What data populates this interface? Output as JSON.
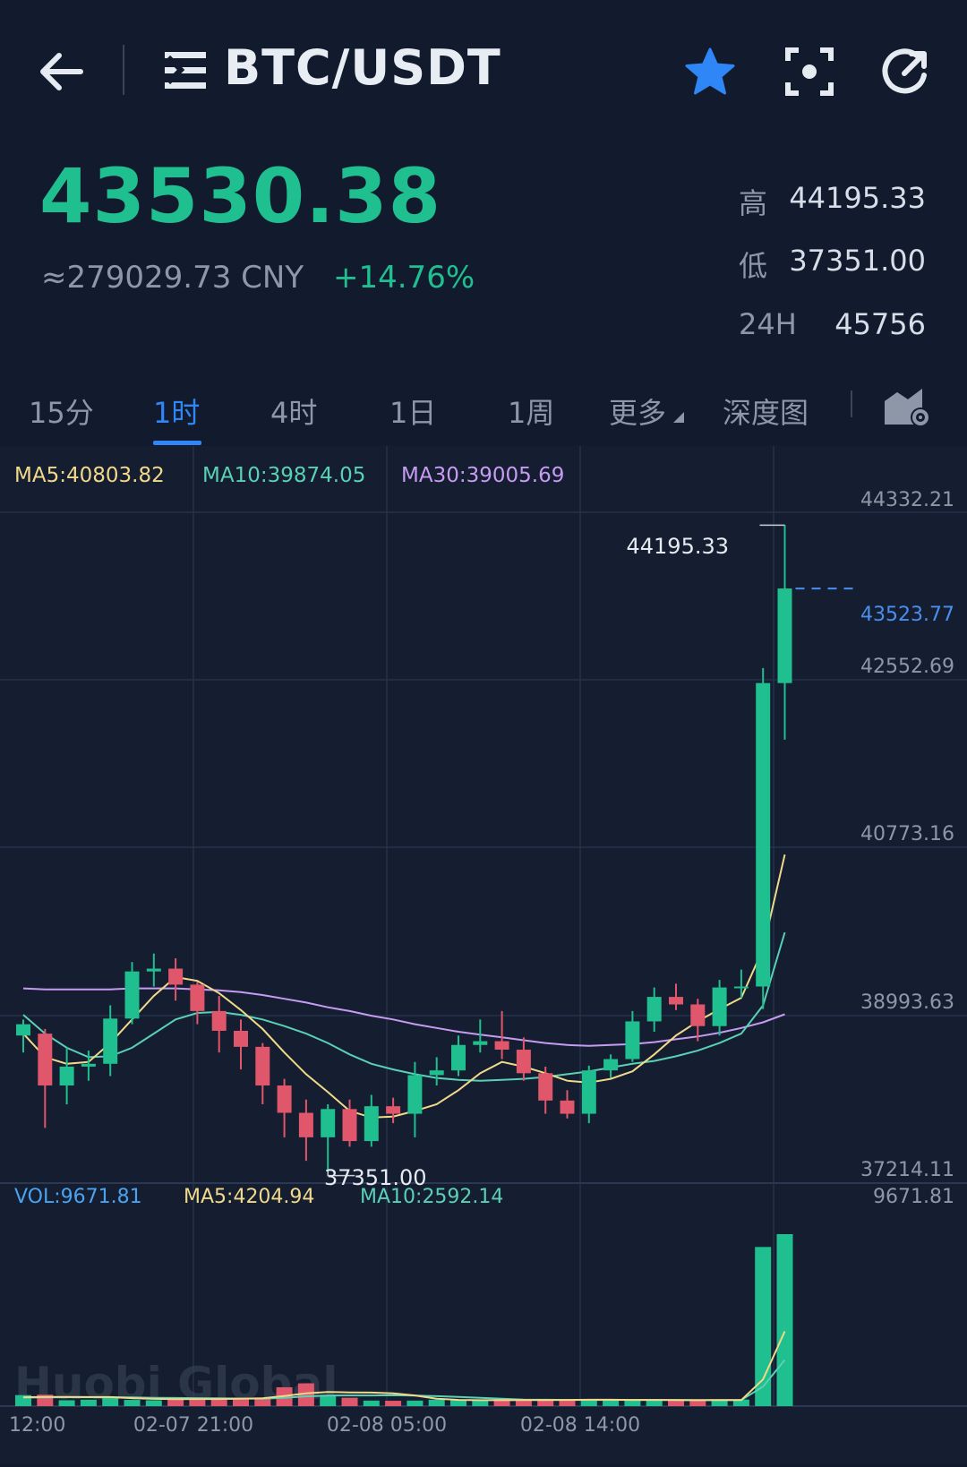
{
  "header": {
    "pair": "BTC/USDT",
    "icons": [
      "back-arrow-icon",
      "menu-icon",
      "star-icon",
      "scan-icon",
      "refresh-icon"
    ],
    "star_color": "#2f86f6"
  },
  "ticker": {
    "price": "43530.38",
    "cny": "≈279029.73 CNY",
    "change_pct": "+14.76%",
    "high_label": "高",
    "high_value": "44195.33",
    "low_label": "低",
    "low_value": "37351.00",
    "vol_label": "24H",
    "vol_value": "45756",
    "up_color": "#1fbf8f",
    "down_color": "#e0566b"
  },
  "tabs": [
    {
      "label": "15分",
      "active": false
    },
    {
      "label": "1时",
      "active": true
    },
    {
      "label": "4时",
      "active": false
    },
    {
      "label": "1日",
      "active": false
    },
    {
      "label": "1周",
      "active": false
    },
    {
      "label": "更多",
      "active": false
    },
    {
      "label": "深度图",
      "active": false
    }
  ],
  "indicators": {
    "ma5": "MA5:40803.82",
    "ma10": "MA10:39874.05",
    "ma30": "MA30:39005.69",
    "vol": "VOL:9671.81",
    "vol_ma5": "MA5:4204.94",
    "vol_ma10": "MA10:2592.14"
  },
  "watermark": "Huobi Global",
  "chart_data": {
    "type": "candlestick",
    "price_axis_labels": [
      "44332.21",
      "42552.69",
      "40773.16",
      "38993.63",
      "37214.11"
    ],
    "ylim": [
      37214.11,
      44332.21
    ],
    "volume_axis_label": "9671.81",
    "volume_max": 9671.81,
    "current_price_label": "43523.77",
    "current_price": 43523.77,
    "high_annotation": "44195.33",
    "low_annotation": "37351.00",
    "x_tick_labels": [
      "12:00",
      "02-07 21:00",
      "02-08 05:00",
      "02-08 14:00"
    ],
    "candles": [
      {
        "o": 38780,
        "h": 38950,
        "l": 38600,
        "c": 38900
      },
      {
        "o": 38800,
        "h": 38850,
        "l": 37800,
        "c": 38250
      },
      {
        "o": 38250,
        "h": 38650,
        "l": 38050,
        "c": 38450
      },
      {
        "o": 38450,
        "h": 38620,
        "l": 38300,
        "c": 38480
      },
      {
        "o": 38480,
        "h": 39100,
        "l": 38350,
        "c": 38960
      },
      {
        "o": 38960,
        "h": 39560,
        "l": 38900,
        "c": 39460
      },
      {
        "o": 39460,
        "h": 39650,
        "l": 39300,
        "c": 39490
      },
      {
        "o": 39490,
        "h": 39600,
        "l": 39150,
        "c": 39320
      },
      {
        "o": 39320,
        "h": 39350,
        "l": 38900,
        "c": 39040
      },
      {
        "o": 39040,
        "h": 39200,
        "l": 38600,
        "c": 38830
      },
      {
        "o": 38830,
        "h": 38950,
        "l": 38420,
        "c": 38660
      },
      {
        "o": 38660,
        "h": 38700,
        "l": 38050,
        "c": 38250
      },
      {
        "o": 38250,
        "h": 38320,
        "l": 37700,
        "c": 37960
      },
      {
        "o": 37960,
        "h": 38100,
        "l": 37450,
        "c": 37700
      },
      {
        "o": 37700,
        "h": 38050,
        "l": 37351,
        "c": 38000
      },
      {
        "o": 38000,
        "h": 38100,
        "l": 37600,
        "c": 37660
      },
      {
        "o": 37660,
        "h": 38150,
        "l": 37600,
        "c": 38030
      },
      {
        "o": 38030,
        "h": 38120,
        "l": 37850,
        "c": 37950
      },
      {
        "o": 37950,
        "h": 38500,
        "l": 37700,
        "c": 38360
      },
      {
        "o": 38360,
        "h": 38550,
        "l": 38250,
        "c": 38410
      },
      {
        "o": 38410,
        "h": 38780,
        "l": 38350,
        "c": 38680
      },
      {
        "o": 38680,
        "h": 38950,
        "l": 38600,
        "c": 38720
      },
      {
        "o": 38720,
        "h": 39040,
        "l": 38530,
        "c": 38630
      },
      {
        "o": 38630,
        "h": 38760,
        "l": 38300,
        "c": 38380
      },
      {
        "o": 38380,
        "h": 38450,
        "l": 37950,
        "c": 38090
      },
      {
        "o": 38090,
        "h": 38200,
        "l": 37900,
        "c": 37950
      },
      {
        "o": 37950,
        "h": 38460,
        "l": 37850,
        "c": 38410
      },
      {
        "o": 38410,
        "h": 38580,
        "l": 38330,
        "c": 38530
      },
      {
        "o": 38530,
        "h": 39040,
        "l": 38500,
        "c": 38930
      },
      {
        "o": 38930,
        "h": 39290,
        "l": 38820,
        "c": 39190
      },
      {
        "o": 39190,
        "h": 39330,
        "l": 39050,
        "c": 39110
      },
      {
        "o": 39110,
        "h": 39170,
        "l": 38720,
        "c": 38880
      },
      {
        "o": 38880,
        "h": 39370,
        "l": 38780,
        "c": 39290
      },
      {
        "o": 39290,
        "h": 39480,
        "l": 39180,
        "c": 39300
      },
      {
        "o": 39300,
        "h": 42680,
        "l": 39060,
        "c": 42520
      },
      {
        "o": 42520,
        "h": 44195.33,
        "l": 41920,
        "c": 43523.77
      }
    ],
    "ma5": [
      38800,
      38550,
      38480,
      38500,
      38700,
      38950,
      39200,
      39400,
      39360,
      39230,
      39050,
      38850,
      38600,
      38370,
      38180,
      37980,
      37910,
      37920,
      37980,
      38050,
      38200,
      38380,
      38500,
      38450,
      38380,
      38300,
      38280,
      38320,
      38400,
      38580,
      38780,
      38930,
      39060,
      39180,
      39700,
      40700
    ],
    "ma10": [
      39000,
      38800,
      38650,
      38550,
      38560,
      38650,
      38800,
      38950,
      39020,
      39030,
      39000,
      38950,
      38880,
      38800,
      38700,
      38580,
      38480,
      38420,
      38370,
      38330,
      38310,
      38300,
      38310,
      38320,
      38340,
      38370,
      38400,
      38440,
      38480,
      38510,
      38560,
      38620,
      38700,
      38800,
      39100,
      39874.05
    ],
    "ma30": [
      39280,
      39270,
      39270,
      39270,
      39270,
      39280,
      39280,
      39280,
      39270,
      39260,
      39240,
      39210,
      39170,
      39130,
      39080,
      39040,
      38990,
      38950,
      38900,
      38860,
      38820,
      38790,
      38760,
      38730,
      38700,
      38680,
      38670,
      38680,
      38690,
      38710,
      38740,
      38770,
      38810,
      38860,
      38920,
      39005.69
    ],
    "volume": [
      620,
      640,
      330,
      360,
      520,
      350,
      330,
      370,
      460,
      410,
      430,
      480,
      1060,
      1280,
      640,
      470,
      310,
      300,
      310,
      360,
      330,
      320,
      330,
      380,
      340,
      360,
      370,
      350,
      340,
      330,
      320,
      310,
      360,
      370,
      8950,
      9671.81
    ],
    "vol_ma5": [
      500,
      520,
      520,
      510,
      510,
      450,
      410,
      390,
      400,
      400,
      420,
      440,
      570,
      720,
      790,
      770,
      760,
      720,
      600,
      420,
      350,
      330,
      330,
      340,
      340,
      350,
      360,
      360,
      350,
      350,
      340,
      330,
      340,
      340,
      1500,
      4204.94
    ],
    "vol_ma10": [
      480,
      490,
      500,
      500,
      500,
      490,
      470,
      460,
      450,
      440,
      430,
      420,
      470,
      550,
      590,
      600,
      600,
      610,
      590,
      560,
      520,
      470,
      420,
      370,
      360,
      350,
      350,
      350,
      350,
      350,
      350,
      340,
      340,
      340,
      1100,
      2592.14
    ],
    "colors": {
      "up": "#1fbf8f",
      "down": "#e0566b",
      "ma5": "#f2d98a",
      "ma10": "#5ad0b5",
      "ma30": "#c79bf2",
      "vol": "#4aa3f0",
      "current": "#4a8ff0"
    }
  }
}
